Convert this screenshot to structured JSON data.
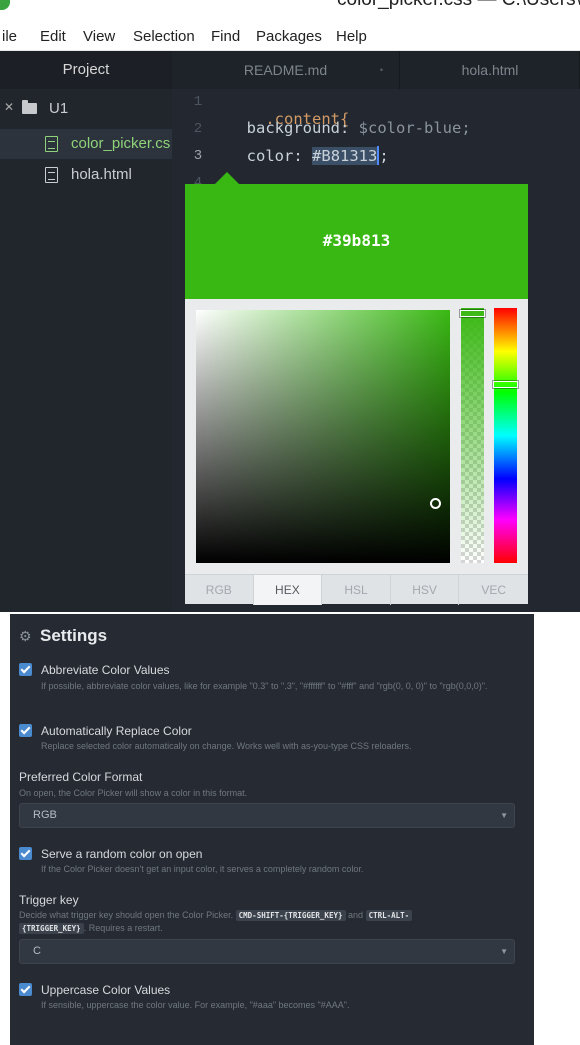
{
  "window": {
    "title": "color_picker.css — C:\\Users\\d"
  },
  "menu": [
    "ile",
    "Edit",
    "View",
    "Selection",
    "Find",
    "Packages",
    "Help"
  ],
  "tree": {
    "header": "Project",
    "folder": "U1",
    "files": [
      "color_picker.cs",
      "hola.html"
    ]
  },
  "tabs": [
    "README.md",
    "hola.html"
  ],
  "editor": {
    "line_numbers": [
      "1",
      "2",
      "3",
      "4"
    ],
    "line1_selector": ".content{",
    "line2_property": "background:",
    "line2_value": "$color-blue;",
    "line3_property": "color:",
    "line3_hash": "#",
    "line3_value": "B81313",
    "line3_end": ";"
  },
  "color_picker": {
    "preview_hex": "#39b813",
    "color": "#39b813",
    "formats": [
      "RGB",
      "HEX",
      "HSL",
      "HSV",
      "VEC"
    ],
    "active_format": "HEX"
  },
  "settings": {
    "title": "Settings",
    "abbreviate": {
      "label": "Abbreviate Color Values",
      "desc": "If possible, abbreviate color values, like for example \"0.3\" to \".3\", \"#ffffff\" to \"#fff\" and \"rgb(0, 0, 0)\" to \"rgb(0,0,0)\".",
      "checked": true
    },
    "auto_replace": {
      "label": "Automatically Replace Color",
      "desc": "Replace selected color automatically on change. Works well with as-you-type CSS reloaders.",
      "checked": true
    },
    "preferred_format": {
      "label": "Preferred Color Format",
      "desc": "On open, the Color Picker will show a color in this format.",
      "value": "RGB"
    },
    "random_color": {
      "label": "Serve a random color on open",
      "desc": "If the Color Picker doesn't get an input color, it serves a completely random color.",
      "checked": true
    },
    "trigger_key": {
      "label": "Trigger key",
      "desc_start": "Decide what trigger key should open the Color Picker.",
      "kbd1": "CMD-SHIFT-{TRIGGER_KEY}",
      "desc_and": "and",
      "kbd2": "CTRL-ALT-",
      "kbd3": "{TRIGGER_KEY}",
      "desc_end": ". Requires a restart.",
      "value": "C"
    },
    "uppercase": {
      "label": "Uppercase Color Values",
      "desc": "If sensible, uppercase the color value. For example, \"#aaa\" becomes \"#AAA\".",
      "checked": true
    }
  }
}
